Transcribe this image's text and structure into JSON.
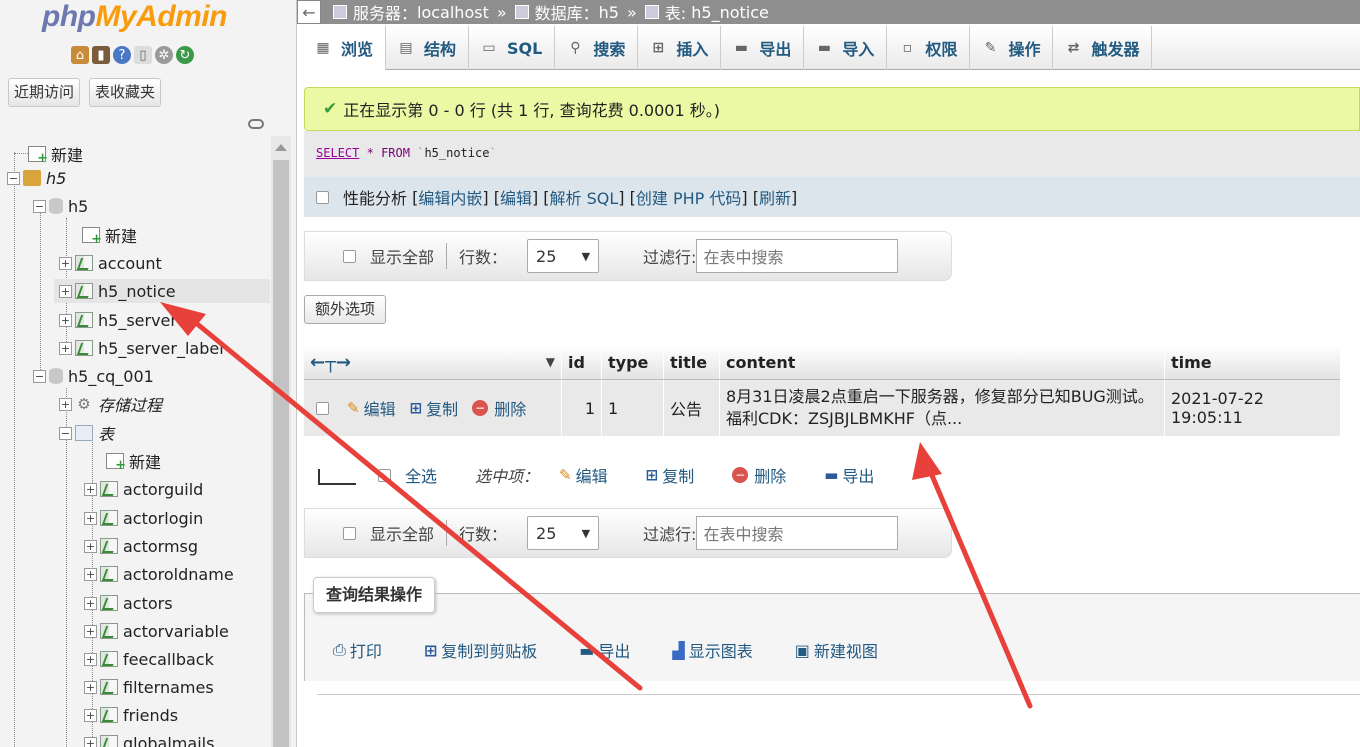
{
  "logo": {
    "part1": "php",
    "part2": "MyAdmin"
  },
  "sidebar": {
    "recent_btn": "近期访问",
    "fav_btn": "表收藏夹",
    "tree": {
      "new_root": "新建",
      "db_h5_group": "h5",
      "db_h5": "h5",
      "h5_new": "新建",
      "account": "account",
      "h5_notice": "h5_notice",
      "h5_server": "h5_server",
      "h5_server_label": "h5_server_label",
      "db_cq": "h5_cq_001",
      "procs": "存储过程",
      "tables": "表",
      "tables_new": "新建",
      "items": [
        "actorguild",
        "actorlogin",
        "actormsg",
        "actoroldname",
        "actors",
        "actorvariable",
        "feecallback",
        "filternames",
        "friends",
        "globalmails"
      ]
    }
  },
  "breadcrumb": {
    "server_label": "服务器：",
    "server": "localhost",
    "db_label": "数据库：",
    "db": "h5",
    "table_label": "表:",
    "table": "h5_notice",
    "sep": "»"
  },
  "tabs": [
    "浏览",
    "结构",
    "SQL",
    "搜索",
    "插入",
    "导出",
    "导入",
    "权限",
    "操作",
    "触发器"
  ],
  "success": "正在显示第 0 - 0 行 (共 1 行, 查询花费 0.0001 秒。)",
  "sql": {
    "select": "SELECT",
    "star": "*",
    "from": "FROM",
    "table": "h5_notice"
  },
  "perf": {
    "label": "性能分析",
    "links": [
      "编辑内嵌",
      "编辑",
      "解析 SQL",
      "创建 PHP 代码",
      "刷新"
    ]
  },
  "nav": {
    "show_all": "显示全部",
    "rows_label": "行数：",
    "rows_value": "25",
    "filter_label": "过滤行:",
    "filter_placeholder": "在表中搜索"
  },
  "extra_options": "额外选项",
  "grid": {
    "columns": [
      "id",
      "type",
      "title",
      "content",
      "time"
    ],
    "row": {
      "edit": "编辑",
      "copy": "复制",
      "delete": "删除",
      "id": "1",
      "type": "1",
      "title": "公告",
      "content_line1": "8月31日凌晨2点重启一下服务器，修复部分已知BUG测试。",
      "content_line2": "福利CDK：ZSJBJLBMKHF（点...",
      "time": "2021-07-22 19:05:11"
    }
  },
  "selection": {
    "check_all": "全选",
    "with_selected": "选中项：",
    "edit": "编辑",
    "copy": "复制",
    "delete": "删除",
    "export": "导出"
  },
  "result_ops": {
    "label": "查询结果操作",
    "print": "打印",
    "copy_clipboard": "复制到剪贴板",
    "export": "导出",
    "chart": "显示图表",
    "new_view": "新建视图"
  },
  "colors": {
    "accent": "#235a81",
    "success_bg": "#ebf8a4",
    "annotation_arrow": "#e8403a"
  }
}
